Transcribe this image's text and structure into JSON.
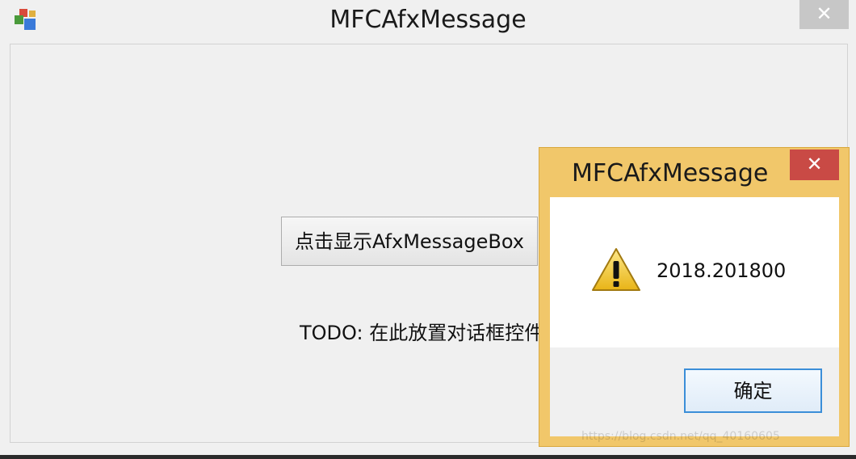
{
  "main_window": {
    "title": "MFCAfxMessage",
    "close_label": "✕",
    "show_button_label": "点击显示AfxMessageBox",
    "todo_text": "TODO: 在此放置对话框控件"
  },
  "message_box": {
    "title": "MFCAfxMessage",
    "close_label": "✕",
    "message": "2018.201800",
    "icon": "warning-icon",
    "ok_button_label": "确定"
  },
  "watermark": "https://blog.csdn.net/qq_40160605",
  "colors": {
    "msgbox_frame": "#f1c76a",
    "msgbox_close": "#c94a45",
    "main_close": "#c7c7c7",
    "ok_border": "#3b8ed8"
  }
}
